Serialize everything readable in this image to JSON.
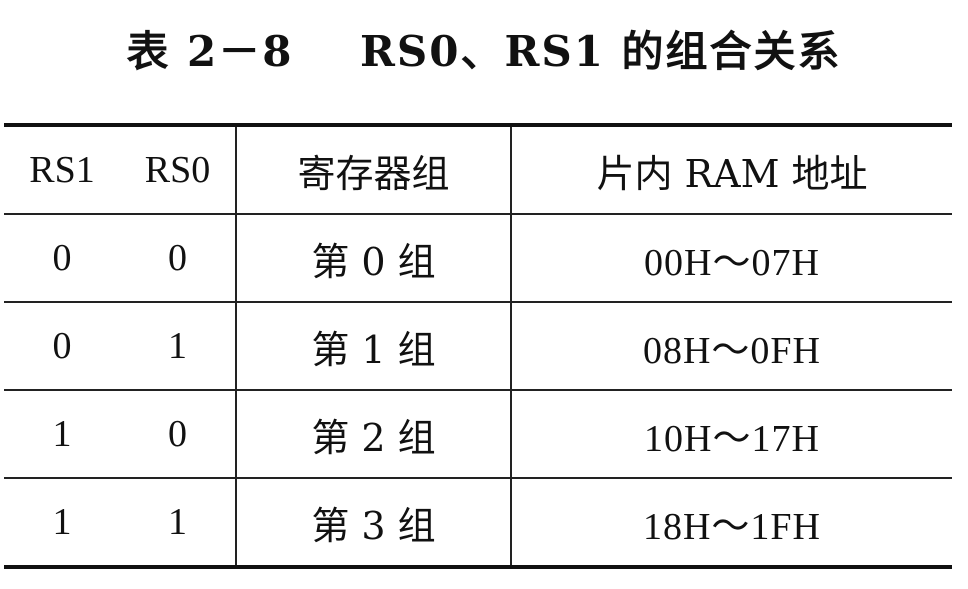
{
  "caption": {
    "label": "表 2－8",
    "title": "RS0、RS1 的组合关系"
  },
  "table": {
    "headers": [
      "RS1",
      "RS0",
      "寄存器组",
      "片内 RAM 地址"
    ],
    "rows": [
      [
        "0",
        "0",
        "第 0 组",
        "00H～07H"
      ],
      [
        "0",
        "1",
        "第 1 组",
        "08H～0FH"
      ],
      [
        "1",
        "0",
        "第 2 组",
        "10H～17H"
      ],
      [
        "1",
        "1",
        "第 3 组",
        "18H～1FH"
      ]
    ]
  }
}
